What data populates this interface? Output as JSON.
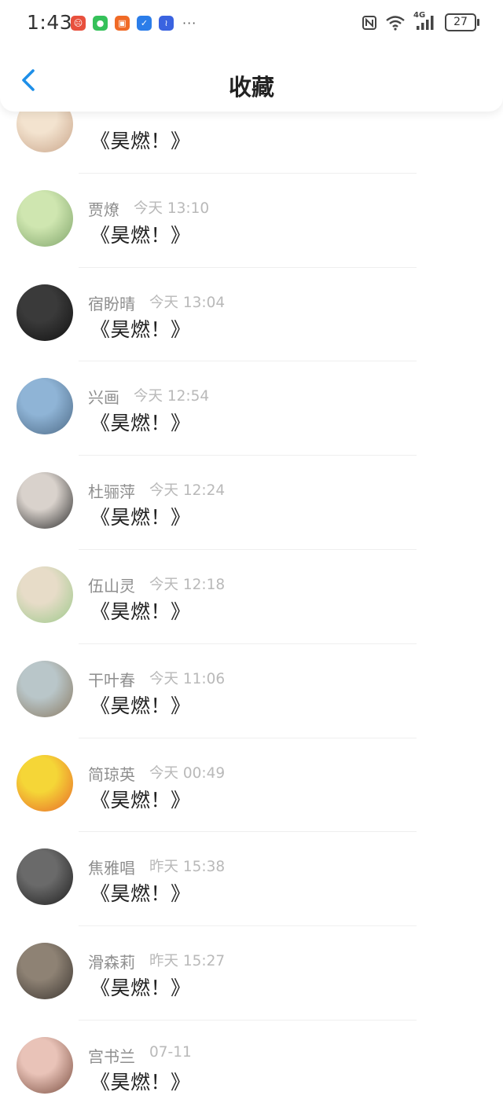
{
  "status_bar": {
    "time": "1:43",
    "dots": "···",
    "battery": "27",
    "network": "4G"
  },
  "header": {
    "title": "收藏",
    "back_icon": "chevron-left-icon"
  },
  "items": [
    {
      "name": "",
      "time": "",
      "message": "《昊燃！》",
      "avatar_colors": [
        "#f3e3cf",
        "#c9a58a"
      ]
    },
    {
      "name": "贾燎",
      "time": "今天 13:10",
      "message": "《昊燃！》",
      "avatar_colors": [
        "#cfe6b0",
        "#7fa46a"
      ]
    },
    {
      "name": "宿盼晴",
      "time": "今天 13:04",
      "message": "《昊燃！》",
      "avatar_colors": [
        "#3a3a3a",
        "#111111"
      ]
    },
    {
      "name": "兴画",
      "time": "今天 12:54",
      "message": "《昊燃！》",
      "avatar_colors": [
        "#8fb4d6",
        "#4d6a86"
      ]
    },
    {
      "name": "杜骊萍",
      "time": "今天 12:24",
      "message": "《昊燃！》",
      "avatar_colors": [
        "#d9d2cc",
        "#2b2b2b"
      ]
    },
    {
      "name": "伍山灵",
      "time": "今天 12:18",
      "message": "《昊燃！》",
      "avatar_colors": [
        "#e7dcc8",
        "#9cc98a"
      ]
    },
    {
      "name": "干叶春",
      "time": "今天 11:06",
      "message": "《昊燃！》",
      "avatar_colors": [
        "#b9c6c9",
        "#8a7a62"
      ]
    },
    {
      "name": "简琼英",
      "time": "今天 00:49",
      "message": "《昊燃！》",
      "avatar_colors": [
        "#f5d637",
        "#e8692a"
      ]
    },
    {
      "name": "焦雅唱",
      "time": "昨天 15:38",
      "message": "《昊燃！》",
      "avatar_colors": [
        "#6a6a6a",
        "#1e1e1e"
      ]
    },
    {
      "name": "滑森莉",
      "time": "昨天 15:27",
      "message": "《昊燃！》",
      "avatar_colors": [
        "#8e8274",
        "#3b3530"
      ]
    },
    {
      "name": "宫书兰",
      "time": "07-11",
      "message": "《昊燃！》",
      "avatar_colors": [
        "#e9c3b8",
        "#7a4e40"
      ]
    }
  ]
}
